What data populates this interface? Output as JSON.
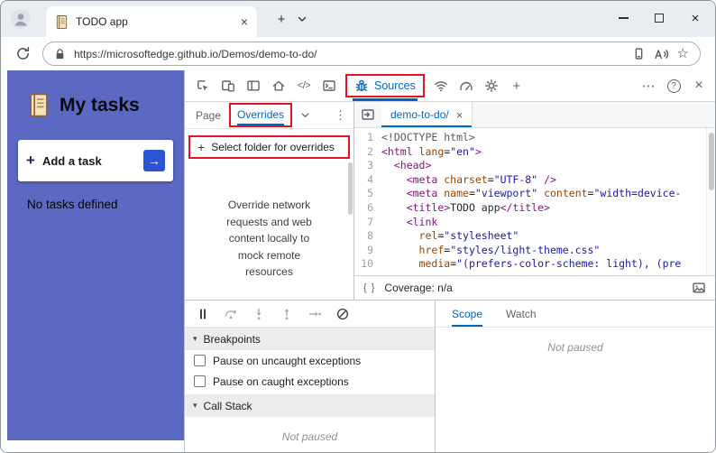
{
  "colors": {
    "accent": "#0067c0",
    "highlight": "#e81123",
    "purple": "#5b69c2",
    "add_button_blue": "#2b55d4"
  },
  "icons": {
    "close": "×",
    "new_tab": "+",
    "add": "+",
    "more": "⋯",
    "overflow_vertical": "⋮",
    "help": "?",
    "elements": "</>",
    "braces": "{ }",
    "star": "☆",
    "arrow_right": "→",
    "section_marker": "▾"
  },
  "browser": {
    "tab_title": "TODO app",
    "url": "https://microsoftedge.github.io/Demos/demo-to-do/"
  },
  "page": {
    "title": "My tasks",
    "add_task": "Add a task",
    "empty": "No tasks defined"
  },
  "devtools": {
    "sources_tab": "Sources",
    "navigator": {
      "page_tab": "Page",
      "overrides_tab": "Overrides",
      "select_folder": "Select folder for overrides",
      "description": "Override network requests and web content locally to mock remote resources"
    },
    "editor": {
      "file_tab": "demo-to-do/",
      "lines": [
        {
          "n": "1",
          "t": [
            [
              "m",
              "<!DOCTYPE html>"
            ]
          ]
        },
        {
          "n": "2",
          "t": [
            [
              "t",
              "<html "
            ],
            [
              "a",
              "lang"
            ],
            [
              "p",
              "="
            ],
            [
              "s",
              "\"en\""
            ],
            [
              "t",
              ">"
            ]
          ]
        },
        {
          "n": "3",
          "t": [
            [
              "p",
              "  "
            ],
            [
              "t",
              "<head>"
            ]
          ]
        },
        {
          "n": "4",
          "t": [
            [
              "p",
              "    "
            ],
            [
              "t",
              "<meta "
            ],
            [
              "a",
              "charset"
            ],
            [
              "p",
              "="
            ],
            [
              "s",
              "\"UTF-8\""
            ],
            [
              "p",
              " "
            ],
            [
              "t",
              "/>"
            ]
          ]
        },
        {
          "n": "5",
          "t": [
            [
              "p",
              "    "
            ],
            [
              "t",
              "<meta "
            ],
            [
              "a",
              "name"
            ],
            [
              "p",
              "="
            ],
            [
              "s",
              "\"viewport\""
            ],
            [
              "p",
              " "
            ],
            [
              "a",
              "content"
            ],
            [
              "p",
              "="
            ],
            [
              "s",
              "\"width=device-"
            ]
          ]
        },
        {
          "n": "6",
          "t": [
            [
              "p",
              "    "
            ],
            [
              "t",
              "<title>"
            ],
            [
              "p",
              "TODO app"
            ],
            [
              "t",
              "</title>"
            ]
          ]
        },
        {
          "n": "7",
          "t": [
            [
              "p",
              "    "
            ],
            [
              "t",
              "<link"
            ]
          ]
        },
        {
          "n": "8",
          "t": [
            [
              "p",
              "      "
            ],
            [
              "a",
              "rel"
            ],
            [
              "p",
              "="
            ],
            [
              "s",
              "\"stylesheet\""
            ]
          ]
        },
        {
          "n": "9",
          "t": [
            [
              "p",
              "      "
            ],
            [
              "a",
              "href"
            ],
            [
              "p",
              "="
            ],
            [
              "s",
              "\"styles/light-theme.css\""
            ]
          ]
        },
        {
          "n": "10",
          "t": [
            [
              "p",
              "      "
            ],
            [
              "a",
              "media"
            ],
            [
              "p",
              "="
            ],
            [
              "s",
              "\"(prefers-color-scheme: light), (pre"
            ]
          ]
        }
      ]
    },
    "statusbar": {
      "coverage": "Coverage: n/a"
    },
    "debugger": {
      "breakpoints": "Breakpoints",
      "checkboxes": [
        "Pause on uncaught exceptions",
        "Pause on caught exceptions"
      ],
      "call_stack": "Call Stack",
      "not_paused": "Not paused"
    },
    "watch": {
      "scope_tab": "Scope",
      "watch_tab": "Watch",
      "not_paused": "Not paused"
    }
  }
}
